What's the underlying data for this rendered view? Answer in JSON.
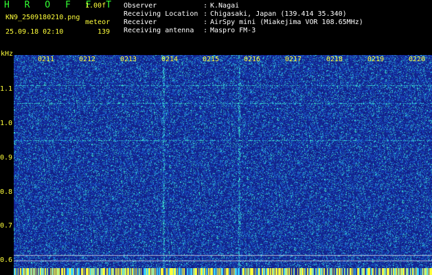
{
  "app": {
    "title": "H R O F F T",
    "version": "1.00f",
    "filename": "KN9_2509180210.png",
    "mode": "meteor",
    "datetime": "25.09.18 02:10",
    "count": "139"
  },
  "info": [
    {
      "label": "Observer",
      "value": "K.Nagai"
    },
    {
      "label": "Receiving Location",
      "value": "Chigasaki, Japan (139.414 35.340)"
    },
    {
      "label": "Receiver",
      "value": "AirSpy mini (Miakejima VOR 108.65MHz)"
    },
    {
      "label": "Receiving antenna",
      "value": "Maspro FM-3"
    }
  ],
  "separator": ":",
  "axis": {
    "unit": "kHz",
    "y_ticks": [
      "1.1",
      "1.0",
      "0.9",
      "0.8",
      "0.7",
      "0.6"
    ],
    "time_ticks": [
      "0211",
      "0212",
      "0213",
      "0214",
      "0215",
      "0216",
      "0217",
      "0218",
      "0219",
      "0220"
    ]
  },
  "colors": {
    "background": "#000000",
    "waterfall_base": "#1c2a9a",
    "noise_bright": "#2bd5d0",
    "text_yellow": "#ffff3a",
    "title_green": "#33ff33",
    "text_white": "#ffffff"
  }
}
